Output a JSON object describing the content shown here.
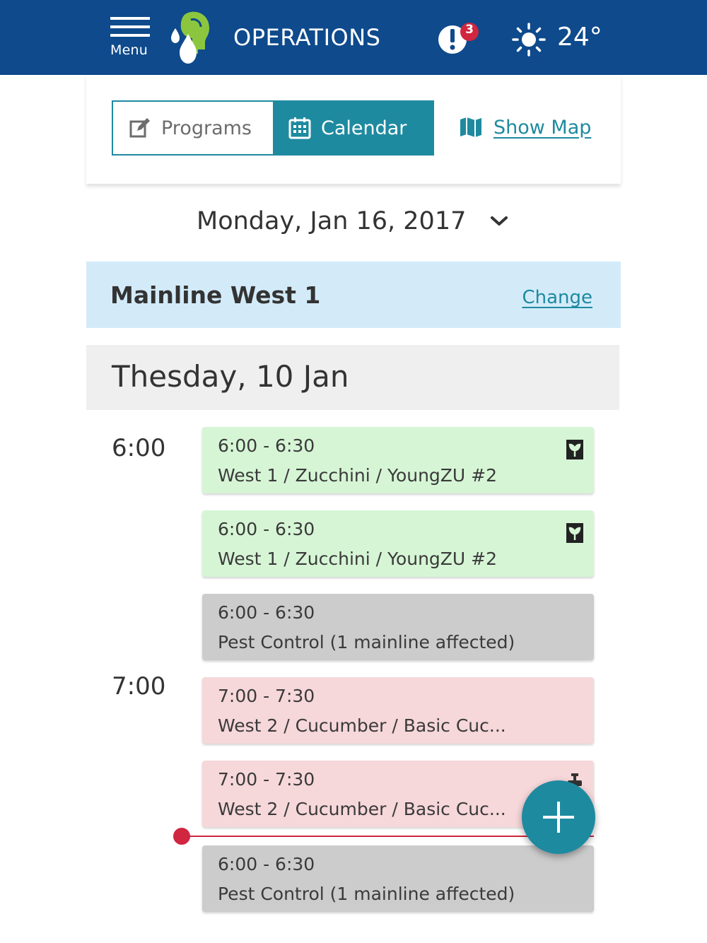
{
  "header": {
    "menu_label": "Menu",
    "title": "OPERATIONS",
    "alert_count": "3",
    "temperature": "24°",
    "icons": {
      "menu": "hamburger-icon",
      "logo": "app-logo",
      "alert": "alert-icon",
      "weather": "sun-icon"
    },
    "colors": {
      "bar": "#0e4a8c",
      "badge": "#d0263f"
    }
  },
  "toolbar": {
    "programs_label": "Programs",
    "calendar_label": "Calendar",
    "active_tab": "Calendar",
    "show_map_label": "Show Map",
    "accent_color": "#1e8aa0"
  },
  "date_picker": {
    "value": "Monday, Jan 16, 2017"
  },
  "mainline": {
    "name": "Mainline West 1",
    "change_label": "Change"
  },
  "day": {
    "title": "Thesday, 10 Jan",
    "time_labels": [
      "6:00",
      "7:00"
    ],
    "events": [
      {
        "time": "6:00 - 6:30",
        "description": "West 1 /  Zucchini / YoungZU #2",
        "status": "green",
        "icon": "fertigation-icon"
      },
      {
        "time": "6:00 - 6:30",
        "description": "West 1 /  Zucchini / YoungZU #2",
        "status": "green",
        "icon": "fertigation-icon"
      },
      {
        "time": "6:00 - 6:30",
        "description": "Pest Control (1 mainline affected)",
        "status": "gray"
      },
      {
        "time": "7:00 - 7:30",
        "description": "West 2 /  Cucumber / Basic Cuc...",
        "status": "red"
      },
      {
        "time": "7:00 - 7:30",
        "description": "West 2 /  Cucumber / Basic Cuc...",
        "status": "red",
        "icon": "valve-icon"
      },
      {
        "time": "6:00 - 6:30",
        "description": "Pest Control (1 mainline affected)",
        "status": "gray"
      }
    ]
  },
  "fab": {
    "icon": "plus-icon"
  }
}
